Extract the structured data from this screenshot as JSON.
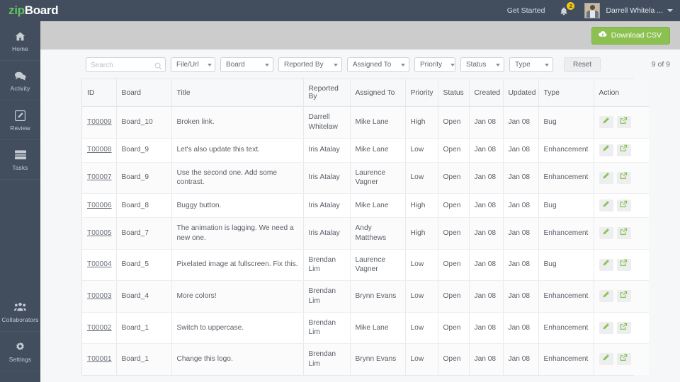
{
  "header": {
    "logo_zip": "zip",
    "logo_board": "Board",
    "get_started": "Get Started",
    "notification_count": "2",
    "user_name": "Darrell Whitela ..."
  },
  "sidebar": {
    "items": [
      {
        "label": "Home",
        "icon": "home-icon"
      },
      {
        "label": "Activity",
        "icon": "comment-icon"
      },
      {
        "label": "Review",
        "icon": "pencil-icon"
      },
      {
        "label": "Tasks",
        "icon": "list-icon"
      },
      {
        "label": "Collaborators",
        "icon": "users-icon"
      },
      {
        "label": "Settings",
        "icon": "gear-icon"
      }
    ]
  },
  "toolbar": {
    "download_csv": "Download CSV"
  },
  "filters": {
    "search_placeholder": "Search",
    "search_value": "",
    "file_url": "File/Url",
    "board": "Board",
    "reported_by": "Reported By",
    "assigned_to": "Assigned To",
    "priority": "Priority",
    "status": "Status",
    "type": "Type",
    "reset": "Reset",
    "count": "9 of 9"
  },
  "table": {
    "columns": [
      "ID",
      "Board",
      "Title",
      "Reported By",
      "Assigned To",
      "Priority",
      "Status",
      "Created",
      "Updated",
      "Type",
      "Action"
    ],
    "rows": [
      {
        "id": "T00009",
        "board": "Board_10",
        "title": "Broken link.",
        "reported_by": "Darrell Whitelaw",
        "assigned_to": "Mike Lane",
        "priority": "High",
        "status": "Open",
        "created": "Jan 08",
        "updated": "Jan 08",
        "type": "Bug"
      },
      {
        "id": "T00008",
        "board": "Board_9",
        "title": "Let's also update this text.",
        "reported_by": "Iris Atalay",
        "assigned_to": "Mike Lane",
        "priority": "Low",
        "status": "Open",
        "created": "Jan 08",
        "updated": "Jan 08",
        "type": "Enhancement"
      },
      {
        "id": "T00007",
        "board": "Board_9",
        "title": "Use the second one. Add some contrast.",
        "reported_by": "Iris Atalay",
        "assigned_to": "Laurence Vagner",
        "priority": "Low",
        "status": "Open",
        "created": "Jan 08",
        "updated": "Jan 08",
        "type": "Enhancement"
      },
      {
        "id": "T00006",
        "board": "Board_8",
        "title": "Buggy button.",
        "reported_by": "Iris Atalay",
        "assigned_to": "Mike Lane",
        "priority": "High",
        "status": "Open",
        "created": "Jan 08",
        "updated": "Jan 08",
        "type": "Bug"
      },
      {
        "id": "T00005",
        "board": "Board_7",
        "title": "The animation is lagging. We need a new one.",
        "reported_by": "Iris Atalay",
        "assigned_to": "Andy Matthews",
        "priority": "High",
        "status": "Open",
        "created": "Jan 08",
        "updated": "Jan 08",
        "type": "Enhancement"
      },
      {
        "id": "T00004",
        "board": "Board_5",
        "title": "Pixelated image at fullscreen. Fix this.",
        "reported_by": "Brendan Lim",
        "assigned_to": "Laurence Vagner",
        "priority": "Low",
        "status": "Open",
        "created": "Jan 08",
        "updated": "Jan 08",
        "type": "Bug"
      },
      {
        "id": "T00003",
        "board": "Board_4",
        "title": "More colors!",
        "reported_by": "Brendan Lim",
        "assigned_to": "Brynn Evans",
        "priority": "Low",
        "status": "Open",
        "created": "Jan 08",
        "updated": "Jan 08",
        "type": "Enhancement"
      },
      {
        "id": "T00002",
        "board": "Board_1",
        "title": "Switch to uppercase.",
        "reported_by": "Brendan Lim",
        "assigned_to": "Mike Lane",
        "priority": "Low",
        "status": "Open",
        "created": "Jan 08",
        "updated": "Jan 08",
        "type": "Enhancement"
      },
      {
        "id": "T00001",
        "board": "Board_1",
        "title": "Change this logo.",
        "reported_by": "Brendan Lim",
        "assigned_to": "Brynn Evans",
        "priority": "Low",
        "status": "Open",
        "created": "Jan 08",
        "updated": "Jan 08",
        "type": "Enhancement"
      }
    ],
    "action_icons": [
      "edit-pencil-icon",
      "open-external-icon"
    ]
  },
  "colors": {
    "brand_green": "#8cc152",
    "header_dark": "#424e5e",
    "toolbar_gray": "#cccccc",
    "page_bg": "#f6f7f8",
    "badge_yellow": "#f0c419"
  }
}
